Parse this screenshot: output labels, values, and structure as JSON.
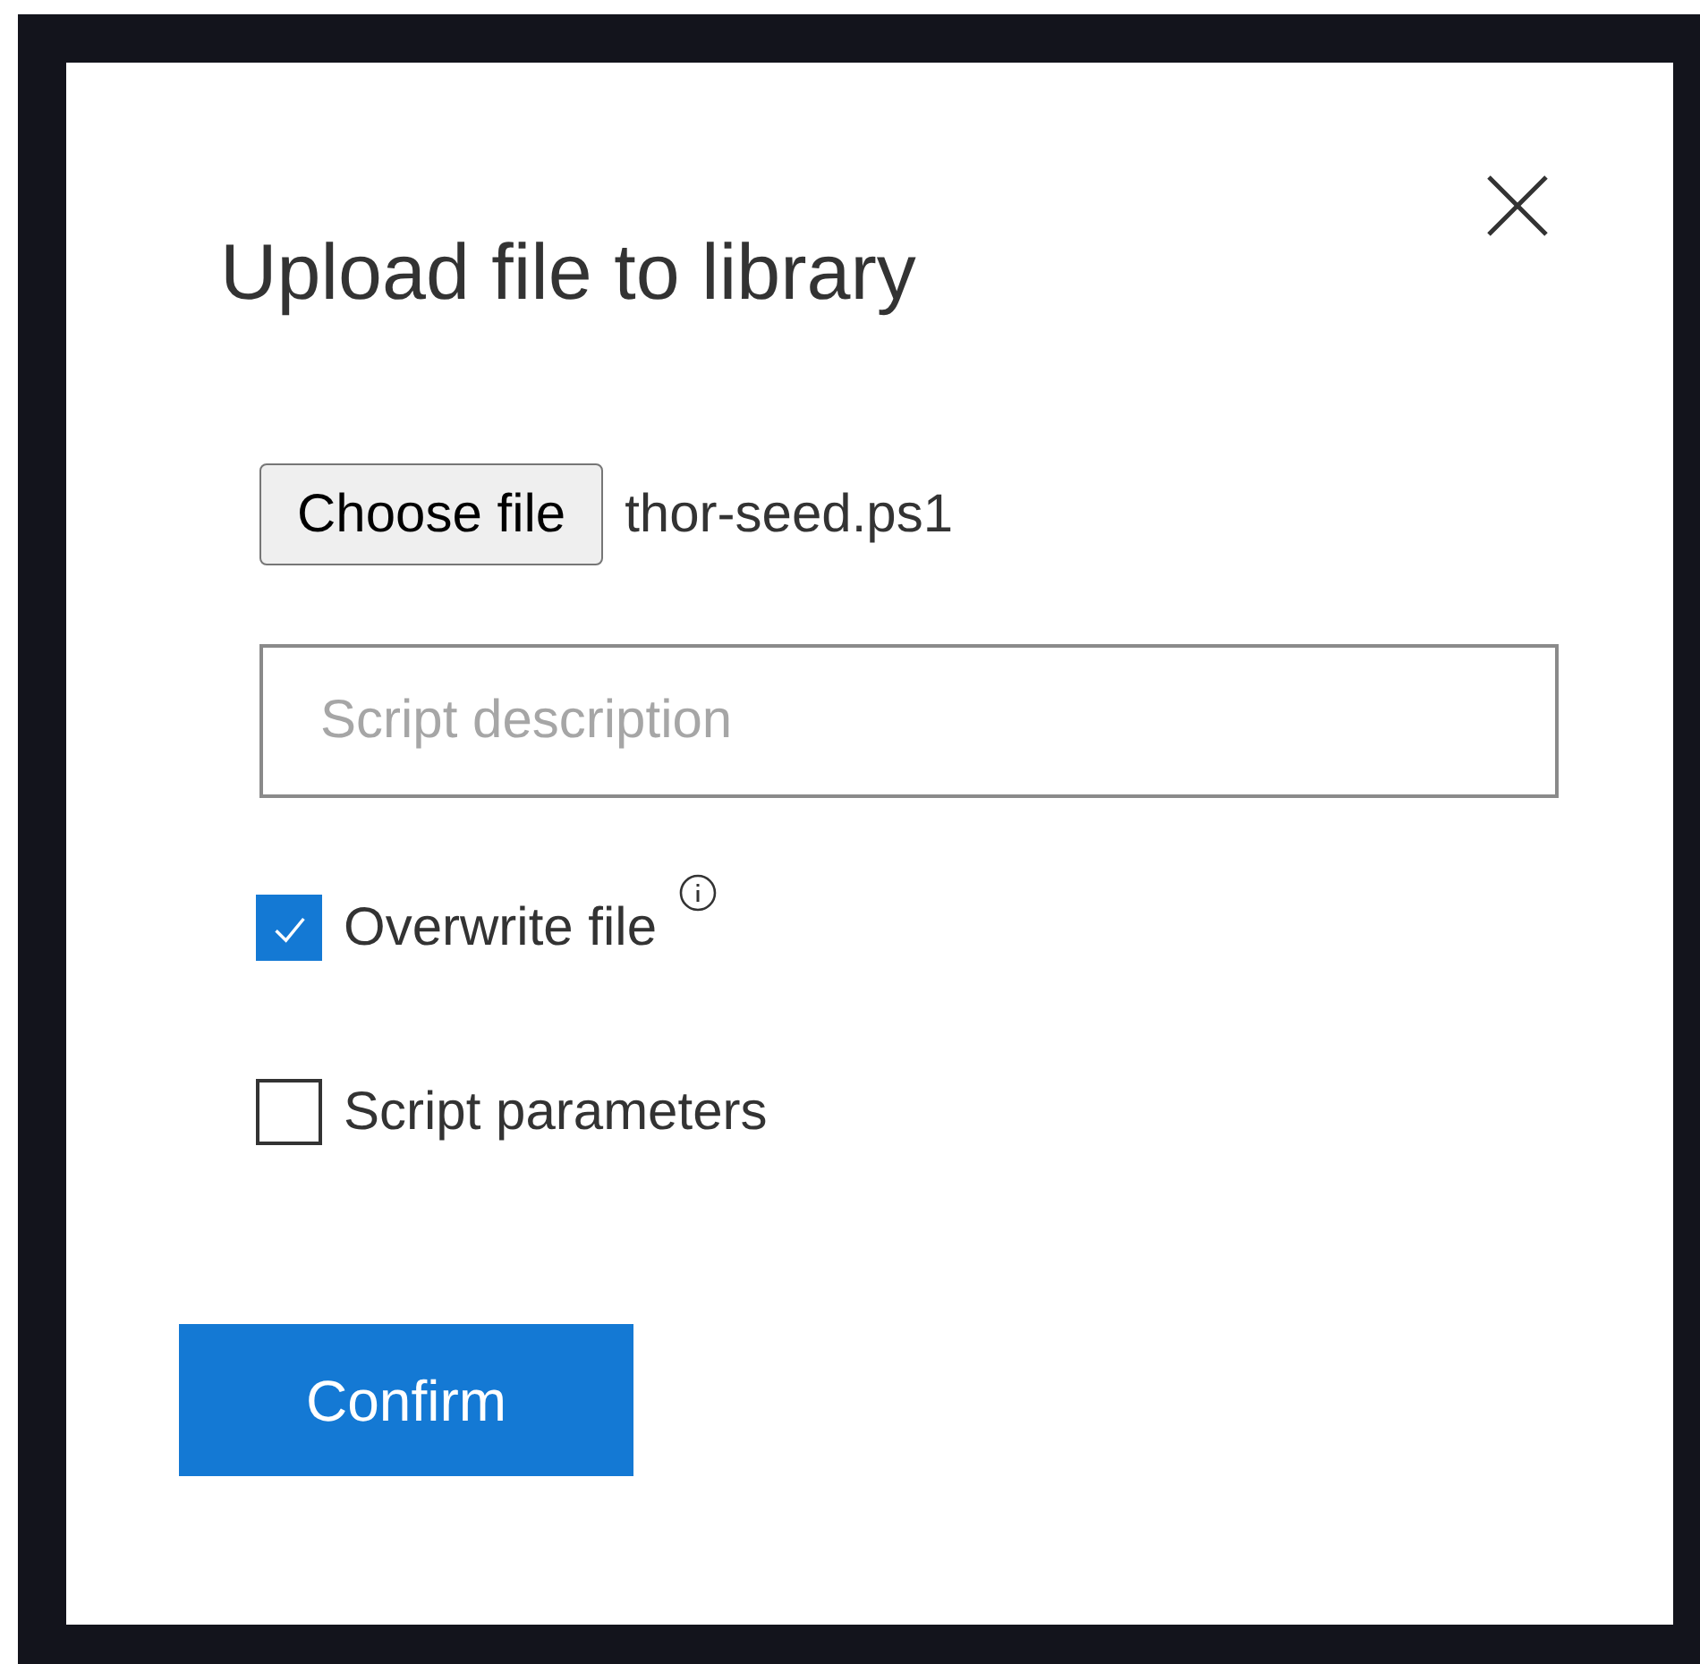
{
  "dialog": {
    "title": "Upload file to library"
  },
  "file_picker": {
    "button": "Choose file",
    "file_name": "thor-seed.ps1"
  },
  "description_field": {
    "placeholder": "Script description"
  },
  "options": [
    {
      "label": "Overwrite file",
      "checked": true,
      "info": true
    },
    {
      "label": "Script parameters",
      "checked": false,
      "info": false
    }
  ],
  "buttons": [
    "Confirm"
  ]
}
